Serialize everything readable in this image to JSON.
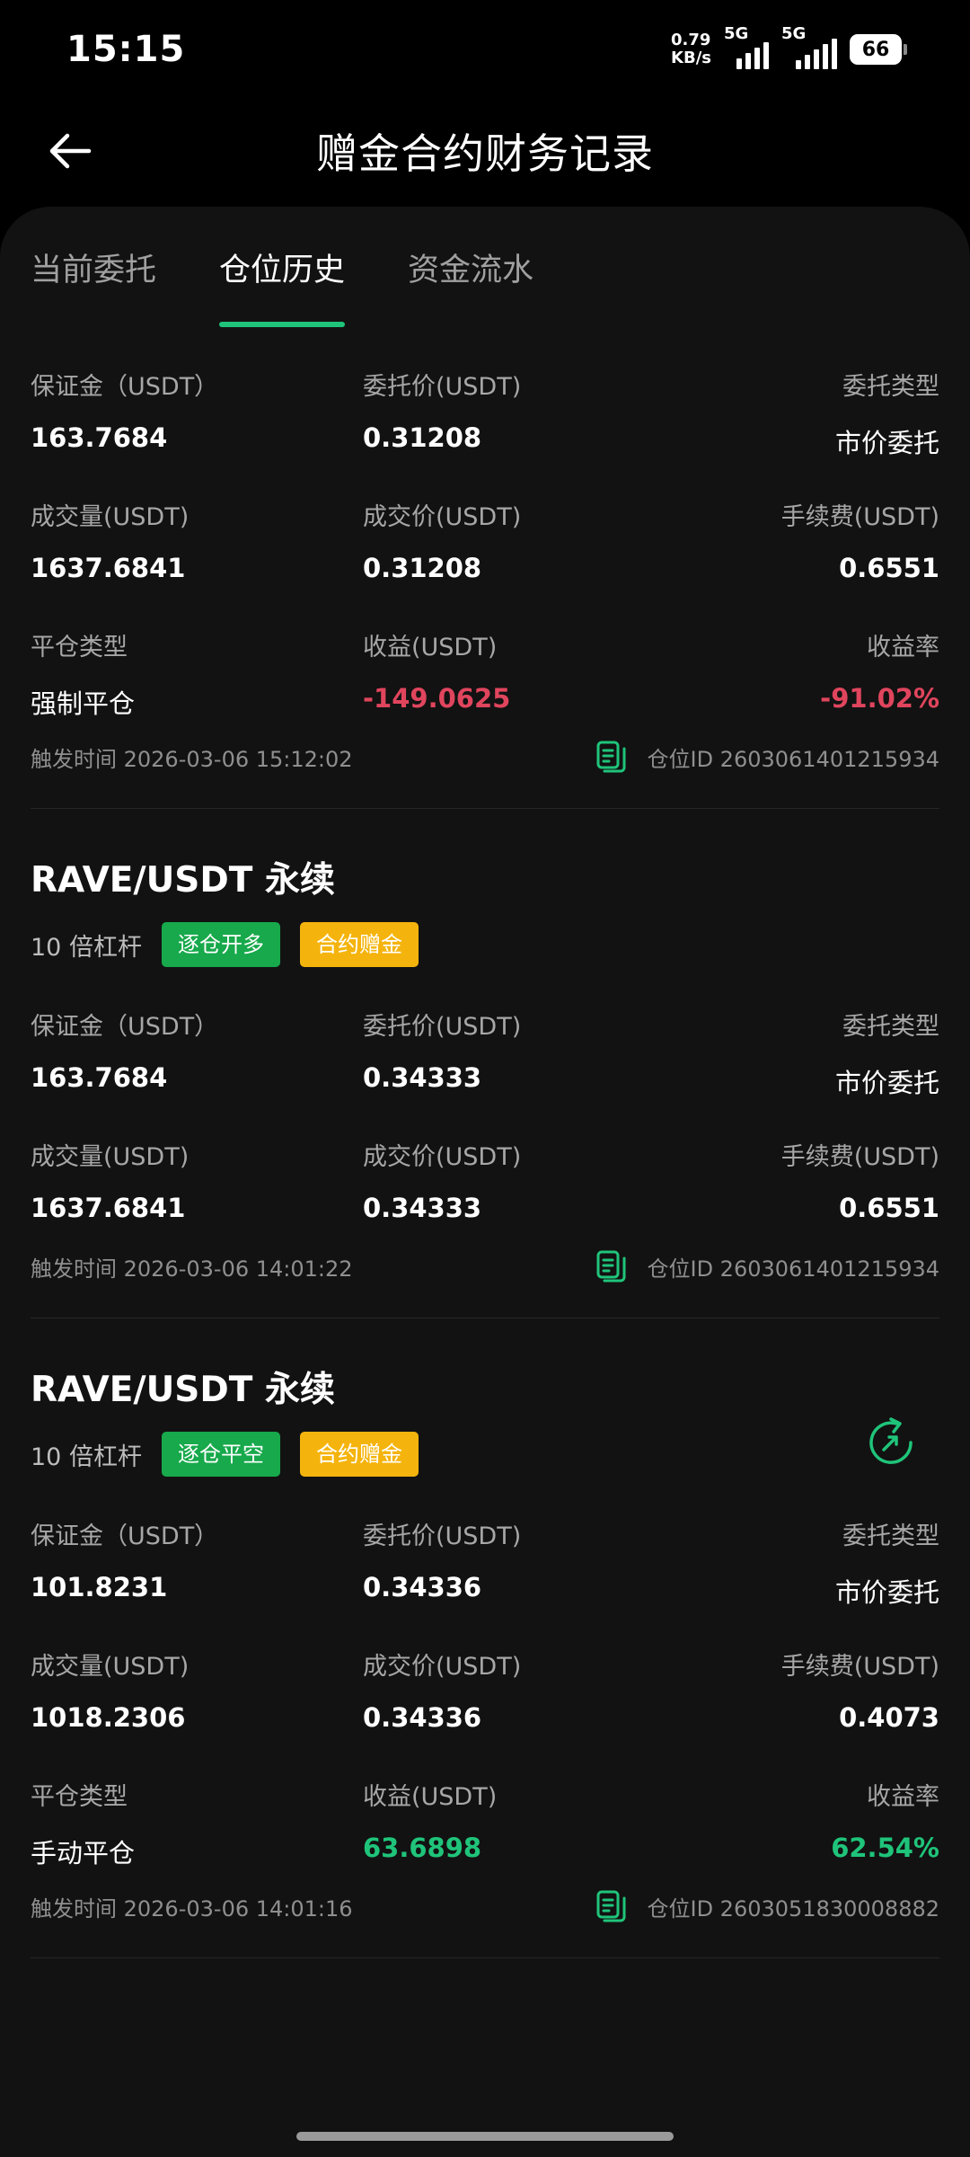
{
  "status_bar": {
    "time": "15:15",
    "net_speed_value": "0.79",
    "net_speed_unit": "KB/s",
    "signal1_label": "5G",
    "signal2_label": "5G",
    "battery": "66"
  },
  "header": {
    "title": "赠金合约财务记录"
  },
  "tabs": [
    {
      "label": "当前委托"
    },
    {
      "label": "仓位历史"
    },
    {
      "label": "资金流水"
    }
  ],
  "records": [
    {
      "margin_label": "保证金（USDT）",
      "margin": "163.7684",
      "order_price_label": "委托价(USDT)",
      "order_price": "0.31208",
      "order_type_label": "委托类型",
      "order_type": "市价委托",
      "volume_label": "成交量(USDT)",
      "volume": "1637.6841",
      "fill_price_label": "成交价(USDT)",
      "fill_price": "0.31208",
      "fee_label": "手续费(USDT)",
      "fee": "0.6551",
      "close_type_label": "平仓类型",
      "close_type": "强制平仓",
      "pnl_label": "收益(USDT)",
      "pnl": "-149.0625",
      "roi_label": "收益率",
      "roi": "-91.02%",
      "trigger_time": "触发时间 2026-03-06 15:12:02",
      "position_id": "仓位ID 2603061401215934"
    },
    {
      "pair": "RAVE/USDT 永续",
      "leverage": "10 倍杠杆",
      "side_badge": "逐仓开多",
      "bonus_badge": "合约赠金",
      "margin_label": "保证金（USDT）",
      "margin": "163.7684",
      "order_price_label": "委托价(USDT)",
      "order_price": "0.34333",
      "order_type_label": "委托类型",
      "order_type": "市价委托",
      "volume_label": "成交量(USDT)",
      "volume": "1637.6841",
      "fill_price_label": "成交价(USDT)",
      "fill_price": "0.34333",
      "fee_label": "手续费(USDT)",
      "fee": "0.6551",
      "trigger_time": "触发时间 2026-03-06 14:01:22",
      "position_id": "仓位ID 2603061401215934"
    },
    {
      "pair": "RAVE/USDT 永续",
      "leverage": "10 倍杠杆",
      "side_badge": "逐仓平空",
      "bonus_badge": "合约赠金",
      "margin_label": "保证金（USDT）",
      "margin": "101.8231",
      "order_price_label": "委托价(USDT)",
      "order_price": "0.34336",
      "order_type_label": "委托类型",
      "order_type": "市价委托",
      "volume_label": "成交量(USDT)",
      "volume": "1018.2306",
      "fill_price_label": "成交价(USDT)",
      "fill_price": "0.34336",
      "fee_label": "手续费(USDT)",
      "fee": "0.4073",
      "close_type_label": "平仓类型",
      "close_type": "手动平仓",
      "pnl_label": "收益(USDT)",
      "pnl": "63.6898",
      "roi_label": "收益率",
      "roi": "62.54%",
      "trigger_time": "触发时间 2026-03-06 14:01:16",
      "position_id": "仓位ID 2603051830008882"
    }
  ],
  "colors": {
    "accent_green": "#1fc47a",
    "loss_red": "#e0455d",
    "badge_green": "#17a94b",
    "badge_yellow": "#f5b40d"
  }
}
